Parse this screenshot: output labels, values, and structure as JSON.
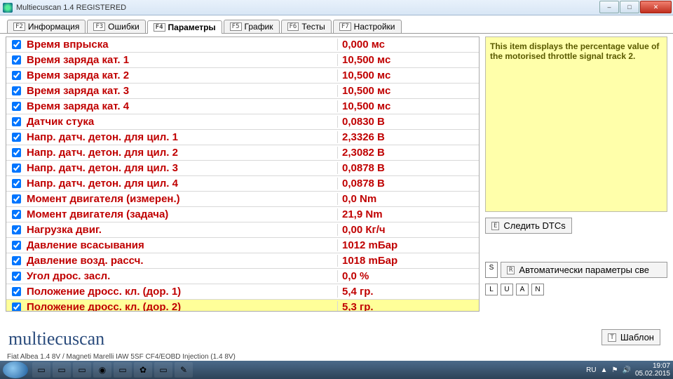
{
  "window": {
    "title": "Multiecuscan 1.4 REGISTERED"
  },
  "tabs": [
    {
      "key": "F2",
      "label": "Информация"
    },
    {
      "key": "F3",
      "label": "Ошибки"
    },
    {
      "key": "F4",
      "label": "Параметры",
      "active": true
    },
    {
      "key": "F5",
      "label": "График"
    },
    {
      "key": "F6",
      "label": "Тесты"
    },
    {
      "key": "F7",
      "label": "Настройки"
    }
  ],
  "params": [
    {
      "name": "Время впрыска",
      "value": "0,000 мс"
    },
    {
      "name": "Время заряда кат. 1",
      "value": "10,500 мс"
    },
    {
      "name": "Время заряда кат. 2",
      "value": "10,500 мс"
    },
    {
      "name": "Время заряда кат. 3",
      "value": "10,500 мс"
    },
    {
      "name": "Время заряда кат. 4",
      "value": "10,500 мс"
    },
    {
      "name": "Датчик стука",
      "value": "0,0830 В"
    },
    {
      "name": "Напр. датч. детон. для цил. 1",
      "value": "2,3326 В"
    },
    {
      "name": "Напр. датч. детон. для цил. 2",
      "value": "2,3082 В"
    },
    {
      "name": "Напр. датч. детон. для цил. 3",
      "value": "0,0878 В"
    },
    {
      "name": "Напр. датч. детон. для цил. 4",
      "value": "0,0878 В"
    },
    {
      "name": "Момент двигателя (измерен.)",
      "value": "0,0 Nm"
    },
    {
      "name": "Момент двигателя (задача)",
      "value": "21,9 Nm"
    },
    {
      "name": "Нагрузка двиг.",
      "value": "0,00 Кг/ч"
    },
    {
      "name": "Давление всасывания",
      "value": "1012 mБар"
    },
    {
      "name": "Давление возд. рассч.",
      "value": "1018 mБар"
    },
    {
      "name": "Угол дрос. засл.",
      "value": "0,0 %"
    },
    {
      "name": "Положение дросс. кл. (дор. 1)",
      "value": "5,4 гр."
    },
    {
      "name": "Положение дросс. кл. (дор. 2)",
      "value": "5,3 гр.",
      "selected": true
    }
  ],
  "info_text": "This item displays the percentage value of the motorised throttle signal track 2.",
  "buttons": {
    "follow_dtc_key": "E",
    "follow_dtc": "Следить DTCs",
    "auto_params_prefix_keys": [
      "S",
      "R"
    ],
    "auto_params": "Автоматически параметры све",
    "bottom_keys": [
      "L",
      "U",
      "A",
      "N"
    ],
    "template_key": "T",
    "template": "Шаблон"
  },
  "logo": "multiecuscan",
  "status": "Fiat Albea 1.4 8V / Magneti Marelli IAW 5SF CF4/EOBD Injection (1.4 8V)",
  "tray": {
    "lang": "RU",
    "time": "19:07",
    "date": "05.02.2015"
  }
}
